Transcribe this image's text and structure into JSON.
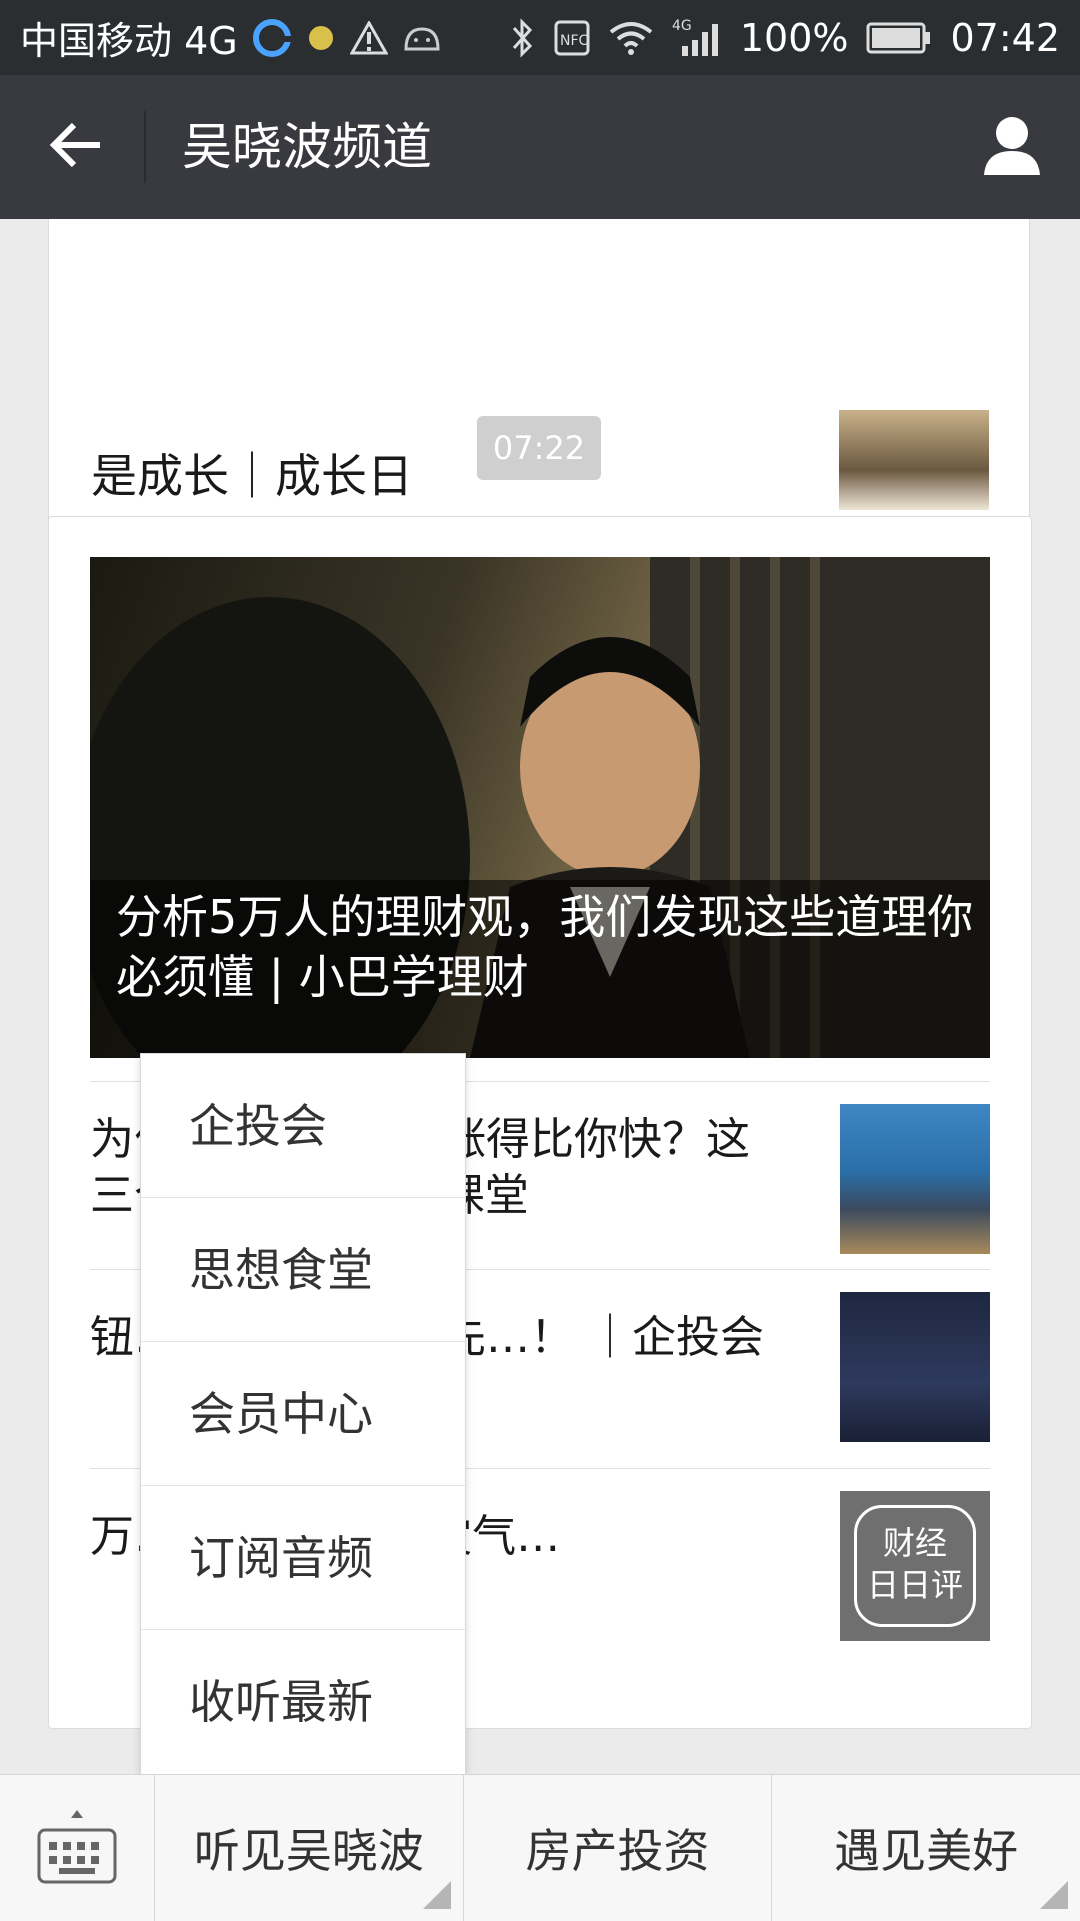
{
  "status_bar": {
    "carrier": "中国移动 4G",
    "battery": "100%",
    "time": "07:42",
    "net_small": "4G"
  },
  "header": {
    "title": "吴晓波频道"
  },
  "feed": {
    "prev_article_tail": "是成长｜成长日",
    "time_badge": "07:22",
    "main_article_title": "分析5万人的理财观，我们发现这些道理你必须懂 | 小巴学理财",
    "items": [
      {
        "text": "为什么有人的财富涨得比你快？这三个重点 | 今晚晓课堂"
      },
      {
        "text": "钮…扩大资产？首先…！ ｜企投会"
      },
      {
        "text": "万…，A股再现股灾气…"
      }
    ],
    "thumb3_label_top": "财经",
    "thumb3_label_bottom": "日日评"
  },
  "popup_menu": {
    "items": [
      "企投会",
      "思想食堂",
      "会员中心",
      "订阅音频",
      "收听最新"
    ]
  },
  "bottom_menu": {
    "items": [
      "听见吴晓波",
      "房产投资",
      "遇见美好"
    ]
  },
  "colors": {
    "title_bar": "#393a3f",
    "status_bar": "#2b2e31",
    "background": "#ebebeb"
  }
}
